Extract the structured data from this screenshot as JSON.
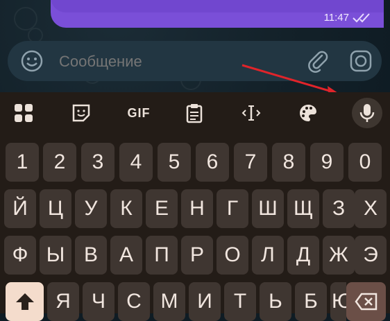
{
  "message": {
    "time": "11:47"
  },
  "composer": {
    "placeholder": "Сообщение"
  },
  "keyboard": {
    "toolbar": {
      "gif_label": "GIF"
    },
    "rows": [
      [
        "1",
        "2",
        "3",
        "4",
        "5",
        "6",
        "7",
        "8",
        "9",
        "0"
      ],
      [
        "Й",
        "Ц",
        "У",
        "К",
        "Е",
        "Н",
        "Г",
        "Ш",
        "Щ",
        "З",
        "Х"
      ],
      [
        "Ф",
        "Ы",
        "В",
        "А",
        "П",
        "Р",
        "О",
        "Л",
        "Д",
        "Ж",
        "Э"
      ],
      [
        "Я",
        "Ч",
        "С",
        "М",
        "И",
        "Т",
        "Ь",
        "Б",
        "Ю"
      ]
    ]
  },
  "colors": {
    "bubble": "#7a4fd8",
    "keyboard_bg": "#231c17",
    "key_bg": "#3f3631",
    "arrow": "#e0242a"
  }
}
